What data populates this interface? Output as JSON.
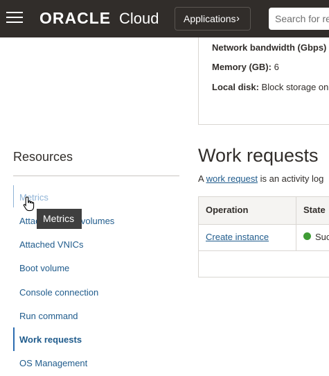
{
  "header": {
    "menu_icon": "hamburger-menu-icon",
    "logo_brand": "ORACLE",
    "logo_product": "Cloud",
    "applications_label": "Applications",
    "applications_chevron": "›",
    "search_placeholder": "Search for res"
  },
  "instance_details": {
    "network_bandwidth_label": "Network bandwidth (Gbps)",
    "memory_label": "Memory (GB):",
    "memory_value": "6",
    "local_disk_label": "Local disk:",
    "local_disk_value": "Block storage on"
  },
  "resources": {
    "title": "Resources",
    "items": [
      {
        "label": "Metrics"
      },
      {
        "label": "Attached block volumes"
      },
      {
        "label": "Attached VNICs"
      },
      {
        "label": "Boot volume"
      },
      {
        "label": "Console connection"
      },
      {
        "label": "Run command"
      },
      {
        "label": "Work requests",
        "active": true
      },
      {
        "label": "OS Management"
      }
    ],
    "tooltip": "Metrics"
  },
  "work_requests": {
    "title": "Work requests",
    "description_prefix": "A ",
    "description_link": "work request",
    "description_suffix": " is an activity log",
    "columns": [
      "Operation",
      "State"
    ],
    "rows": [
      {
        "operation": "Create instance",
        "state": "Suc",
        "state_color": "#3f9c35"
      }
    ]
  }
}
